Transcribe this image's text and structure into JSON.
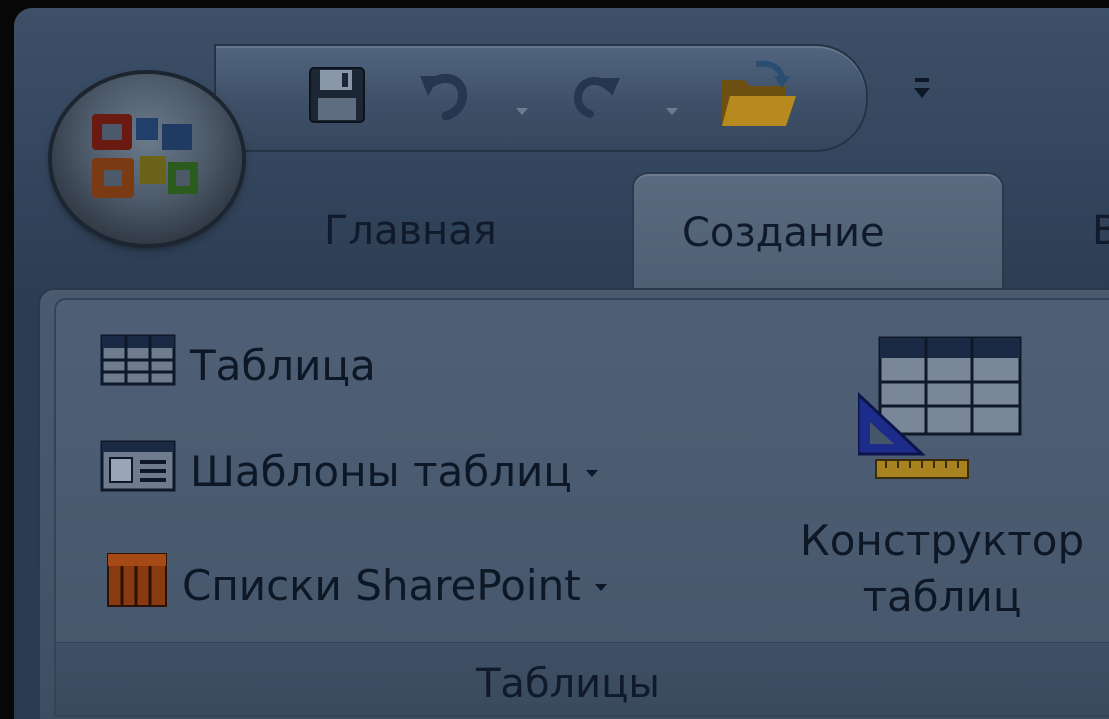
{
  "quick_access": {
    "buttons": [
      {
        "name": "save-icon"
      },
      {
        "name": "undo-icon"
      },
      {
        "name": "redo-icon"
      },
      {
        "name": "open-folder-icon"
      }
    ],
    "customize_icon": "customize-toolbar-icon"
  },
  "office_button": {
    "icon": "office-logo-icon"
  },
  "tabs": [
    {
      "label": "Главная",
      "active": false
    },
    {
      "label": "Создание",
      "active": true
    },
    {
      "label": "В",
      "active": false
    }
  ],
  "ribbon": {
    "group_label": "Таблицы",
    "commands": [
      {
        "label": "Таблица",
        "icon": "table-icon",
        "dropdown": false
      },
      {
        "label": "Шаблоны таблиц",
        "icon": "table-templates-icon",
        "dropdown": true
      },
      {
        "label": "Списки SharePoint",
        "icon": "sharepoint-lists-icon",
        "dropdown": true
      }
    ],
    "big_button": {
      "line1": "Конструктор",
      "line2": "таблиц",
      "icon": "table-design-icon"
    }
  },
  "colors": {
    "text": "#0d1726",
    "ribbon_bg": "#45566b",
    "active_tab": "#4d5d72",
    "frame_bg": "#070707"
  }
}
